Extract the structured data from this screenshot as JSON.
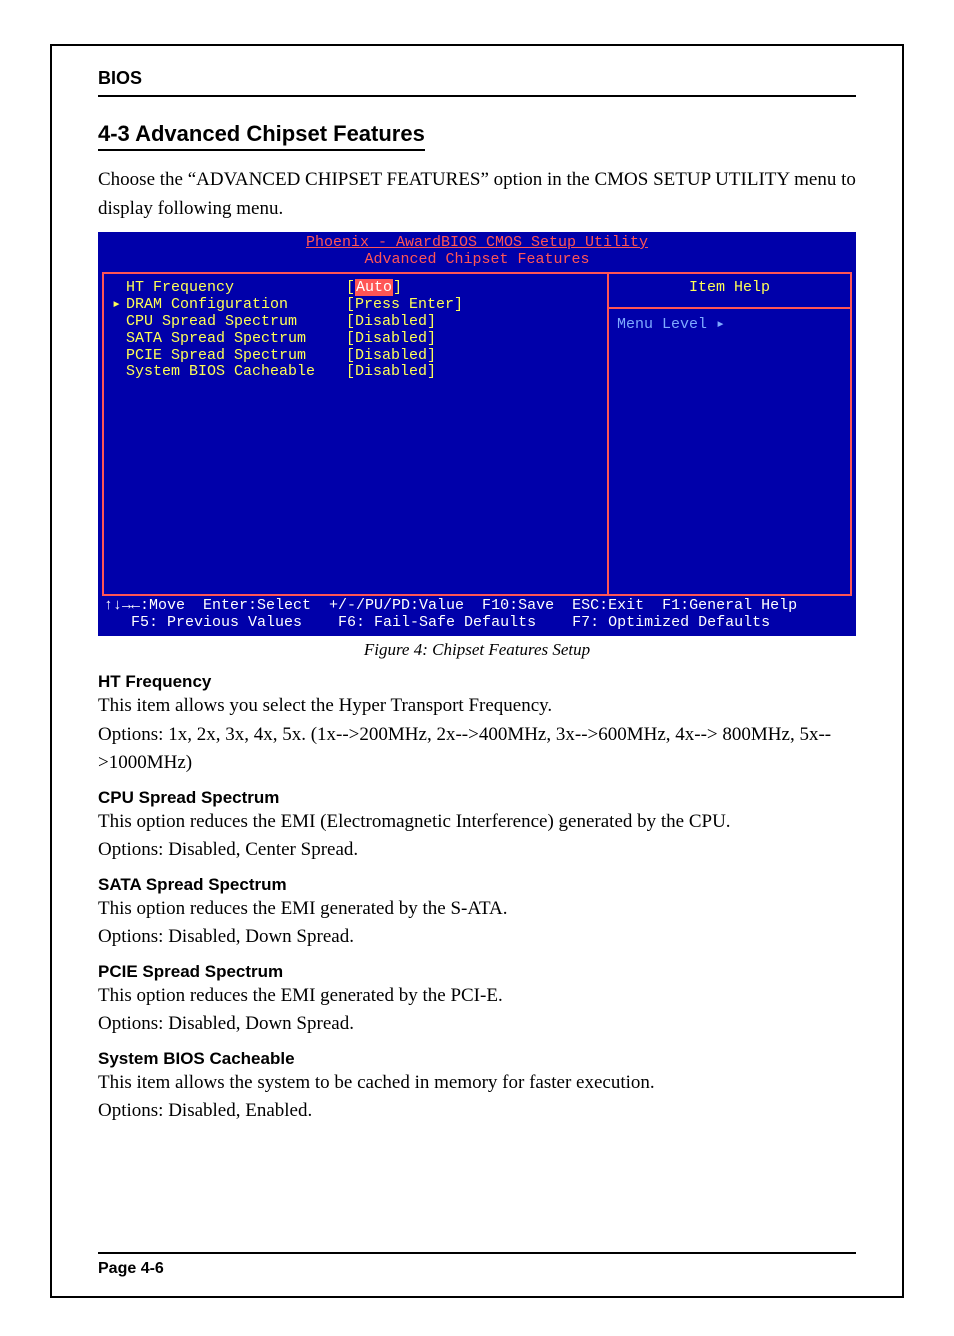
{
  "header": "BIOS",
  "section_title": "4-3 Advanced Chipset Features",
  "intro": "Choose the “ADVANCED CHIPSET FEATURES” option  in the CMOS SETUP UTILITY menu to display following menu.",
  "bios": {
    "title_line1": "Phoenix - AwardBIOS CMOS Setup Utility",
    "title_line2": "Advanced Chipset Features",
    "rows": [
      {
        "arrow": "",
        "label": "HT Frequency",
        "value": "Auto",
        "selected": true
      },
      {
        "arrow": "▸",
        "label": "DRAM Configuration",
        "value": "Press Enter",
        "selected": false
      },
      {
        "arrow": "",
        "label": "CPU Spread Spectrum",
        "value": "Disabled",
        "selected": false
      },
      {
        "arrow": "",
        "label": "SATA Spread Spectrum",
        "value": "Disabled",
        "selected": false
      },
      {
        "arrow": "",
        "label": "PCIE Spread Spectrum",
        "value": "Disabled",
        "selected": false
      },
      {
        "arrow": "",
        "label": "System BIOS Cacheable",
        "value": "Disabled",
        "selected": false
      }
    ],
    "item_help": "Item Help",
    "menu_level": "Menu Level    ▸",
    "footer1": "↑↓→←:Move  Enter:Select  +/-/PU/PD:Value  F10:Save  ESC:Exit  F1:General Help",
    "footer2": "   F5: Previous Values    F6: Fail-Safe Defaults    F7: Optimized Defaults"
  },
  "caption": "Figure 4:  Chipset Features Setup",
  "items": [
    {
      "head": "HT  Frequency",
      "p1": "This item allows you select the Hyper Transport Frequency.",
      "p2": "Options: 1x, 2x, 3x, 4x, 5x. (1x-->200MHz, 2x-->400MHz, 3x-->600MHz, 4x--> 800MHz, 5x-->1000MHz)"
    },
    {
      "head": "CPU Spread Spectrum",
      "p1": "This option reduces the EMI (Electromagnetic Interference) generated by the CPU.",
      "p2": "Options: Disabled, Center Spread."
    },
    {
      "head": "SATA Spread Spectrum",
      "p1": "This option reduces the EMI generated by the S-ATA.",
      "p2": "Options: Disabled, Down Spread."
    },
    {
      "head": "PCIE Spread Spectrum",
      "p1": "This option reduces the EMI generated by the PCI-E.",
      "p2": "Options: Disabled, Down Spread."
    },
    {
      "head": "System BIOS Cacheable",
      "p1": "This item allows the system to be cached in memory for faster execution.",
      "p2": "Options: Disabled, Enabled."
    }
  ],
  "page_footer": "Page 4-6"
}
